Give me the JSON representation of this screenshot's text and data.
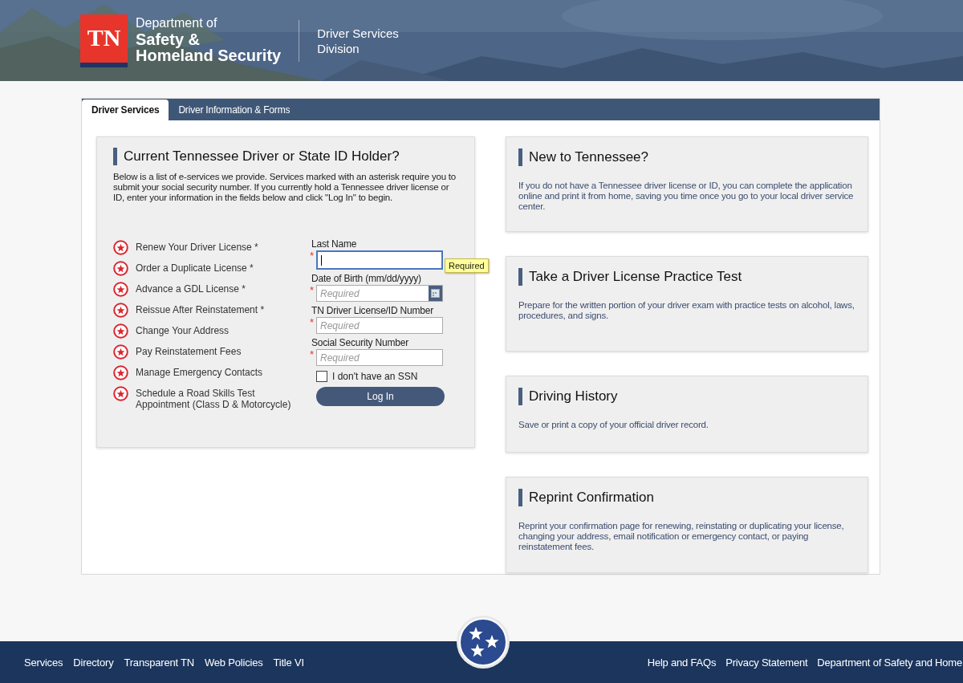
{
  "header": {
    "logo_text": "TN",
    "department": [
      "Department of",
      "Safety &",
      "Homeland Security"
    ],
    "division": [
      "Driver Services",
      "Division"
    ]
  },
  "tabs": [
    {
      "label": "Driver Services",
      "selected": true
    },
    {
      "label": "Driver Information & Forms",
      "selected": false
    }
  ],
  "login_card": {
    "title": "Current Tennessee Driver or State ID Holder?",
    "intro": "Below is a list of e-services we provide. Services marked with an asterisk require you to submit your social security number. If you currently hold a Tennessee driver license or ID, enter your information in the fields below and click \"Log In\" to begin.",
    "services": [
      "Renew Your Driver License *",
      "Order a Duplicate License *",
      "Advance a GDL License *",
      "Reissue After Reinstatement *",
      "Change Your Address",
      "Pay Reinstatement Fees",
      "Manage Emergency Contacts",
      "Schedule a Road Skills Test Appointment (Class D & Motorcycle)"
    ],
    "fields": [
      {
        "label": "Last Name",
        "kind": "text",
        "required_mark": "*",
        "focused": true,
        "tooltip": "Required"
      },
      {
        "label": "Date of Birth (mm/dd/yyyy)",
        "kind": "date",
        "required_mark": "*",
        "focused": false,
        "placeholder": "Required"
      },
      {
        "label": "TN Driver License/ID Number",
        "kind": "text",
        "required_mark": "*",
        "focused": false,
        "placeholder": "Required"
      },
      {
        "label": "Social Security Number",
        "kind": "text",
        "required_mark": "*",
        "focused": false,
        "placeholder": "Required"
      }
    ],
    "checkbox": {
      "label": "I don't have an SSN",
      "checked": false
    },
    "button": "Log In"
  },
  "info_cards": [
    {
      "title": "New to Tennessee?",
      "text": "If you do not have a Tennessee driver license or ID, you can complete the application online and print it from home, saving you time once you go to your local driver service center."
    },
    {
      "title": "Take a Driver License Practice Test",
      "text": "Prepare for the written portion of your driver exam with practice tests on alcohol, laws, procedures, and signs."
    },
    {
      "title": "Driving History",
      "text": "Save or print a copy of your official driver record."
    },
    {
      "title": "Reprint Confirmation",
      "text": "Reprint your confirmation page for renewing, reinstating or duplicating your license, changing your address, email notification or emergency contact, or paying reinstatement fees."
    }
  ],
  "footer": {
    "left_links": [
      "Services",
      "Directory",
      "Transparent TN",
      "Web Policies",
      "Title VI"
    ],
    "right_links": [
      "Help and FAQs",
      "Privacy Statement",
      "Department of Safety and Home"
    ]
  }
}
